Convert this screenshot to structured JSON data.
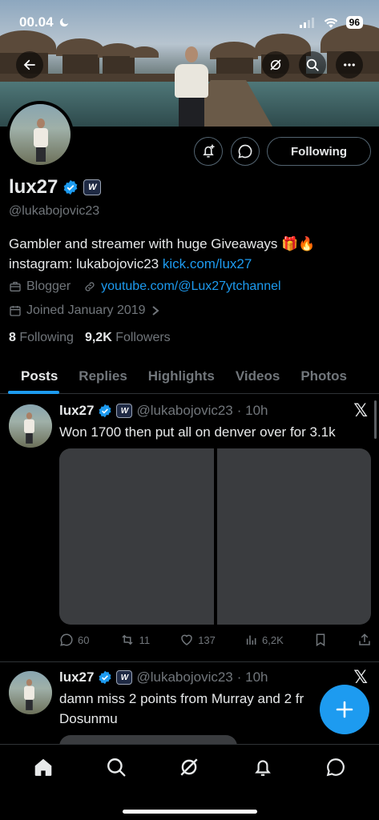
{
  "status_bar": {
    "time": "00.04",
    "battery": "96"
  },
  "profile": {
    "name": "lux27",
    "affiliate_badge": "W",
    "handle": "@lukabojovic23",
    "bio_line1": "Gambler and streamer with huge Giveaways 🎁🔥",
    "bio_line2_prefix": "instagram: lukabojovic23 ",
    "bio_link": "kick.com/lux27",
    "category": "Blogger",
    "website": "youtube.com/@Lux27ytchannel",
    "joined": "Joined January 2019",
    "following_count": "8",
    "following_label": "Following",
    "followers_count": "9,2K",
    "followers_label": "Followers",
    "follow_button": "Following"
  },
  "tabs": [
    "Posts",
    "Replies",
    "Highlights",
    "Videos",
    "Photos"
  ],
  "tweets": [
    {
      "name": "lux27",
      "handle": "@lukabojovic23",
      "time": "· 10h",
      "text": "Won 1700 then put all on denver over for 3.1k",
      "replies": "60",
      "reposts": "11",
      "likes": "137",
      "views": "6,2K"
    },
    {
      "name": "lux27",
      "handle": "@lukabojovic23",
      "time": "· 10h",
      "text": "damn miss 2 points from Murray and 2 fr Dosunmu"
    }
  ],
  "icons": {
    "back": "back-arrow-icon",
    "grok": "grok-icon",
    "search": "search-icon",
    "more": "more-icon",
    "notify": "notification-add-icon",
    "message": "message-icon",
    "x": "x-logo-icon",
    "compose": "plus-icon"
  },
  "colors": {
    "accent": "#1d9bf0",
    "muted": "#71767b",
    "background": "#000000"
  }
}
